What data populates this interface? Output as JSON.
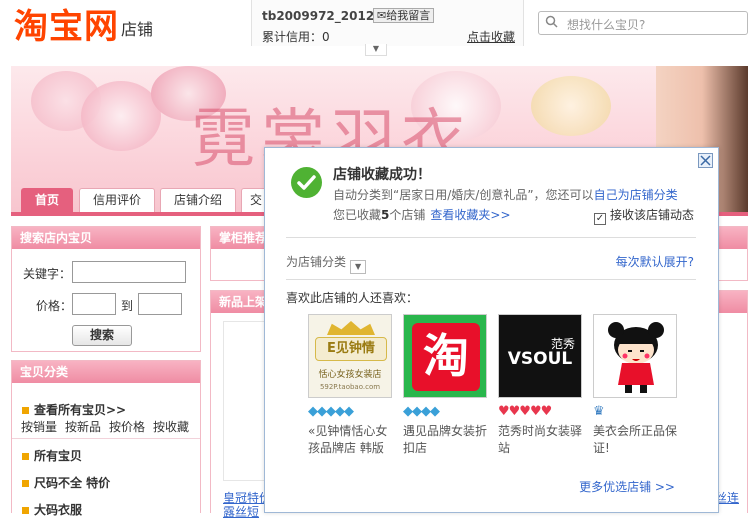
{
  "header": {
    "logo_main": "淘宝网",
    "logo_sub": "店铺",
    "seller_name": "tb2009972_2012",
    "leave_msg": "给我留言",
    "credit_label": "累计信用：",
    "credit_value": "0",
    "favorite_link": "点击收藏",
    "search_placeholder": "想找什么宝贝?"
  },
  "banner": {
    "title": "霓裳羽衣"
  },
  "nav": {
    "tabs": [
      {
        "label": "首页",
        "active": true
      },
      {
        "label": "信用评价",
        "active": false
      },
      {
        "label": "店铺介绍",
        "active": false
      },
      {
        "label": "交",
        "active": false
      }
    ]
  },
  "search_panel": {
    "title": "搜索店内宝贝",
    "keyword_label": "关键字：",
    "price_label": "价格：",
    "to_label": "到",
    "search_button": "搜索"
  },
  "category_panel": {
    "title": "宝贝分类",
    "view_all": "查看所有宝贝>>",
    "sorts": [
      "按销量",
      "按新品",
      "按价格",
      "按收藏"
    ],
    "items": [
      "所有宝贝",
      "尺码不全 特价",
      "大码衣服"
    ]
  },
  "middle": {
    "recommend_title": "掌柜推荐",
    "new_title": "新品上架",
    "product_caption_1": "皇冠特价",
    "product_caption_1b": "露丝短",
    "product_caption_2": "丝连"
  },
  "popup": {
    "title": "店铺收藏成功！",
    "auto_prefix": "自动分类到",
    "auto_category": "“居家日用/婚庆/创意礼品”",
    "auto_suffix": "，您还可以",
    "self_classify_link": "自己为店铺分类",
    "collected_prefix": "您已收藏",
    "collected_count": "5",
    "collected_suffix": "个店铺",
    "view_favorites": "查看收藏夹>>",
    "receive_updates": "接收该店铺动态",
    "receive_checked": true,
    "classify_label": "为店铺分类",
    "expand_default": "每次默认展开?",
    "also_like": "喜欢此店铺的人还喜欢：",
    "more_shops": "更多优选店铺 >>",
    "shops": [
      {
        "name": "«见钟情恬心女孩品牌店 韩版",
        "logo_text": "E见钟情",
        "logo_sub": "恬心女孩女装店",
        "logo_url": "592P.taobao.com",
        "rank": "◆◆◆◆◆",
        "rank_color": "#3aa0d8"
      },
      {
        "name": "遇见品牌女装折扣店",
        "logo_text": "淘",
        "rank": "◆◆◆◆",
        "rank_color": "#3aa0d8"
      },
      {
        "name": "范秀时尚女装驿站",
        "logo_text": "VSOUL",
        "logo_sub": "范秀",
        "rank": "♥♥♥♥♥",
        "rank_color": "#e8364d"
      },
      {
        "name": "美衣会所正品保证!",
        "logo_text": "",
        "rank": "♛",
        "rank_color": "#3a7fc2"
      }
    ]
  }
}
